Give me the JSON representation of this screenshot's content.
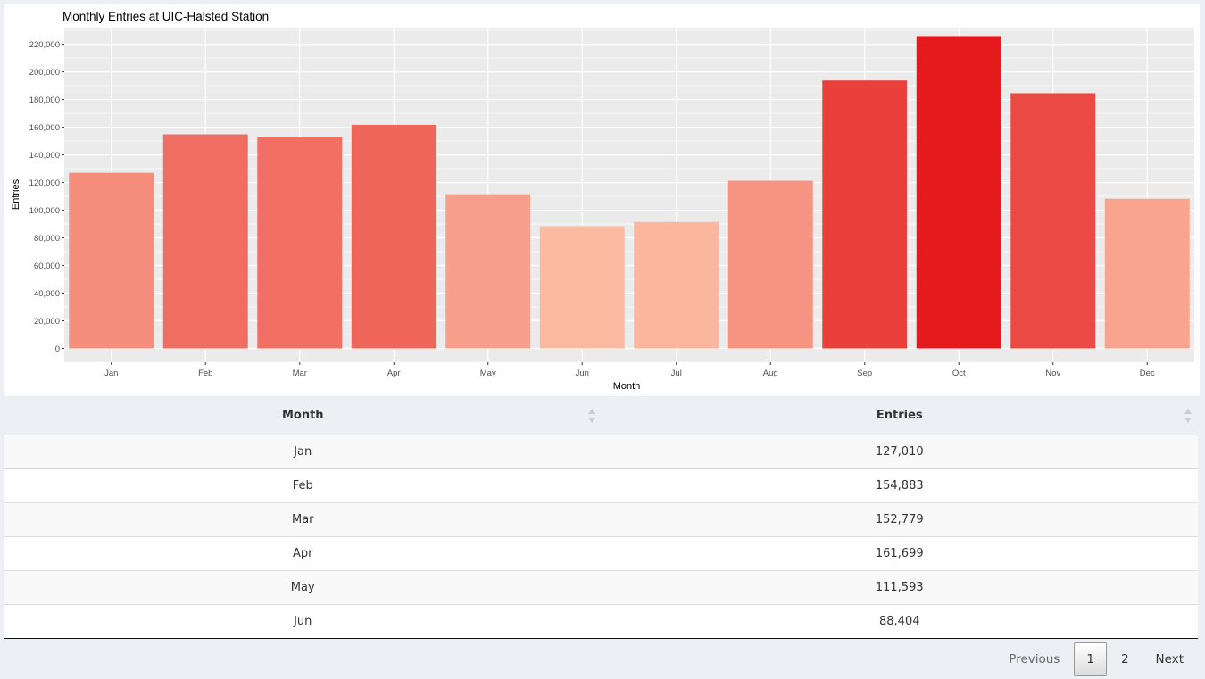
{
  "chart_data": {
    "type": "bar",
    "title": "Monthly Entries at UIC-Halsted Station",
    "xlabel": "Month",
    "ylabel": "Entries",
    "categories": [
      "Jan",
      "Feb",
      "Mar",
      "Apr",
      "May",
      "Jun",
      "Jul",
      "Aug",
      "Sep",
      "Oct",
      "Nov",
      "Dec"
    ],
    "values": [
      127010,
      154883,
      152779,
      161699,
      111593,
      88404,
      91500,
      121300,
      193800,
      225900,
      184600,
      108300
    ],
    "ylim": [
      -10000,
      232000
    ],
    "yticks": [
      0,
      20000,
      40000,
      60000,
      80000,
      100000,
      120000,
      140000,
      160000,
      180000,
      200000,
      220000
    ],
    "ytick_labels": [
      "0",
      "20,000",
      "40,000",
      "60,000",
      "80,000",
      "100,000",
      "120,000",
      "140,000",
      "160,000",
      "180,000",
      "200,000",
      "220,000"
    ],
    "grid": true,
    "legend": "none",
    "panel_background": "#ebebeb",
    "gridline_color": "#ffffff",
    "color_low": "#fcbba1",
    "color_high": "#e41a1c"
  },
  "table": {
    "columns": [
      "Month",
      "Entries"
    ],
    "rows": [
      [
        "Jan",
        "127,010"
      ],
      [
        "Feb",
        "154,883"
      ],
      [
        "Mar",
        "152,779"
      ],
      [
        "Apr",
        "161,699"
      ],
      [
        "May",
        "111,593"
      ],
      [
        "Jun",
        "88,404"
      ]
    ]
  },
  "pagination": {
    "previous": "Previous",
    "pages": [
      "1",
      "2"
    ],
    "current": "1",
    "next": "Next"
  }
}
